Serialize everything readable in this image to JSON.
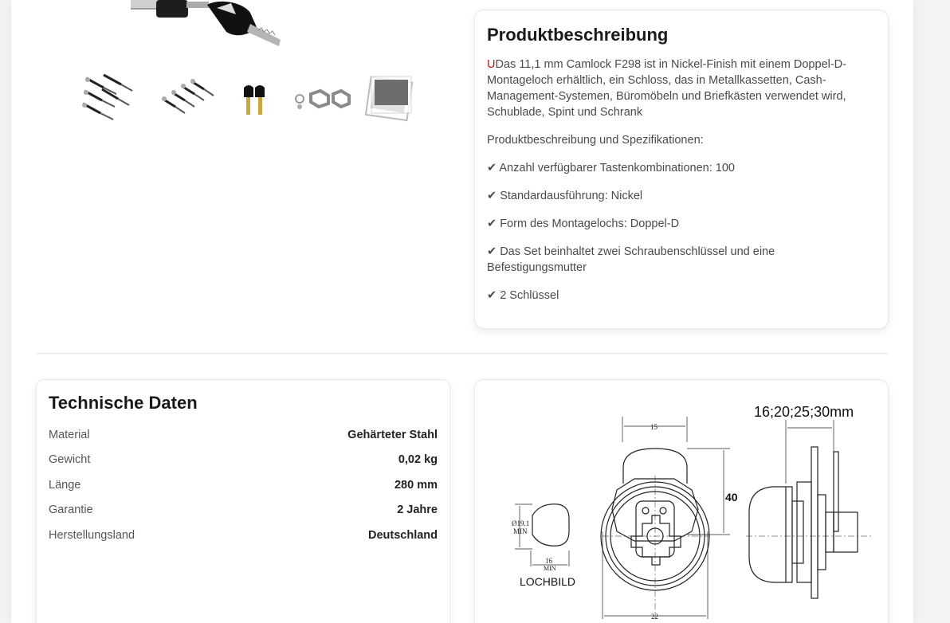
{
  "gallery": {
    "thumbnails": [
      "lock-set-thumbnail-1",
      "lock-set-thumbnail-2",
      "keys-thumbnail",
      "nuts-thumbnail",
      "placeholder-thumbnail"
    ]
  },
  "description": {
    "heading": "Produktbeschreibung",
    "lead_letter": "U",
    "lead_text": "Das 11,1 mm Camlock F298 ist in Nickel-Finish mit einem Doppel-D-Montageloch erhältlich, ein Schloss, das in Metallkassetten, Cash-Management-Systemen, Büromöbeln und Briefkästen verwendet wird, Schublade, Spint und Schrank",
    "subheading": "Produktbeschreibung und Spezifikationen:",
    "check_mark": "✔",
    "features": [
      "Anzahl verfügbarer Tastenkombinationen: 100",
      "Standardausführung: Nickel",
      "Form des Montagelochs: Doppel-D",
      "Das Set beinhaltet zwei Schraubenschlüssel und eine Befestigungsmutter",
      "2 Schlüssel"
    ]
  },
  "tech": {
    "heading": "Technische Daten",
    "rows": [
      {
        "label": "Material",
        "value": "Gehärteter Stahl"
      },
      {
        "label": "Gewicht",
        "value": "0,02 kg"
      },
      {
        "label": "Länge",
        "value": "280 mm"
      },
      {
        "label": "Garantie",
        "value": "2 Jahre"
      },
      {
        "label": "Herstellungsland",
        "value": "Deutschland"
      }
    ]
  },
  "drawing": {
    "length_label": "16;20;25;30mm",
    "height_label": "40",
    "width_top": "15",
    "width_bottom": "22",
    "hole_diameter": "Ø19.1",
    "hole_min": "MIN",
    "hole_width": "16",
    "hole_width_min": "MIN",
    "hole_caption": "LOCHBILD"
  },
  "colors": {
    "accent_red": "#c0161e",
    "text_dark": "#1a1a1a",
    "text_body": "#4a4a4a"
  }
}
